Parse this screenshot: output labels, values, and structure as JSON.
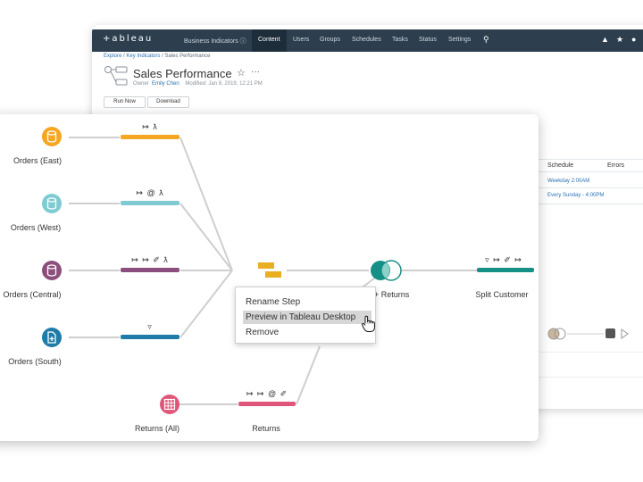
{
  "server": {
    "logo": "+ableau",
    "nav": [
      "Business Indicators ⓘ",
      "Content",
      "Users",
      "Groups",
      "Schedules",
      "Tasks",
      "Status",
      "Settings"
    ],
    "active_nav": "Content",
    "breadcrumb": {
      "items": [
        "Explore",
        "Key Indicators",
        "Sales Performance"
      ],
      "sep": " / "
    },
    "title": "Sales Performance",
    "owner_label": "Owner",
    "owner": "Emily Chen",
    "modified": "Modified: Jan 8, 2019, 12:21 PM",
    "buttons": [
      "Run Now",
      "Download"
    ],
    "table": {
      "headers": [
        "Schedule",
        "Errors"
      ],
      "rows": [
        "Weekday 2:00AM",
        "Every Sunday - 4:00PM"
      ]
    }
  },
  "flow": {
    "inputs": [
      {
        "label": "Orders (East)",
        "color": "#f5a623",
        "ops": "↳⁡ ʂ"
      },
      {
        "label": "Orders (West)",
        "color": "#7ecbd2",
        "ops": ""
      },
      {
        "label": "Orders (Central)",
        "color": "#8c4f7d",
        "ops": ""
      },
      {
        "label": "Orders (South)",
        "color": "#1f7ca8",
        "ops": ""
      }
    ],
    "returns_input": {
      "label": "Returns (All)",
      "color": "#e0567a"
    },
    "returns_step": {
      "label": "Returns"
    },
    "join_label": "s + Returns",
    "split_label": "Split Customer"
  },
  "context_menu": {
    "items": [
      "Rename Step",
      "Preview in Tableau Desktop",
      "Remove"
    ],
    "highlighted_index": 1
  },
  "colors": {
    "east": "#f5a623",
    "west": "#7ecbd2",
    "central": "#8c4f7d",
    "south": "#1f7ca8",
    "returns": "#e0567a",
    "join": "#168f87",
    "split": "#168f87",
    "union": "#e8b020",
    "topbar": "#2d3f4f"
  }
}
